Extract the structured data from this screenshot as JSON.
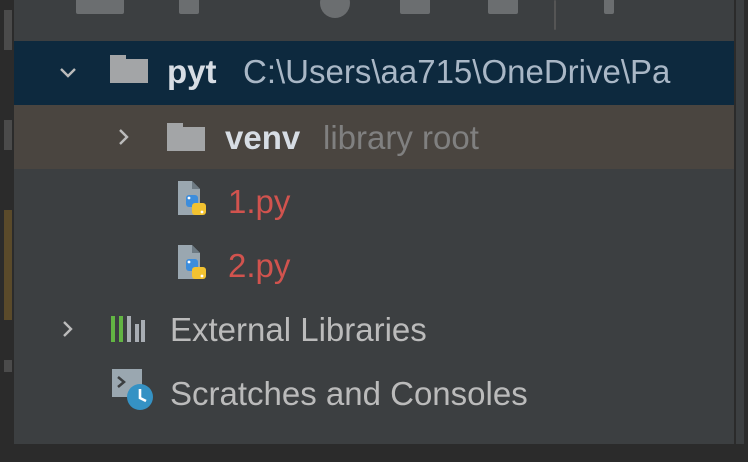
{
  "project_tree": {
    "root": {
      "name": "pyt",
      "path": "C:\\Users\\aa715\\OneDrive\\Pa",
      "expanded": true
    },
    "venv": {
      "name": "venv",
      "hint": "library root",
      "expanded": false
    },
    "files": [
      {
        "name": "1.py"
      },
      {
        "name": "2.py"
      }
    ],
    "external_libraries": {
      "label": "External Libraries"
    },
    "scratches": {
      "label": "Scratches and Consoles"
    }
  },
  "colors": {
    "background": "#3c3f41",
    "selected_row": "#0d293e",
    "hover_row": "#4a4540",
    "unversioned_file": "#d1534e",
    "dim_text": "#808080",
    "scratch_badge": "#3592c4"
  },
  "icons": {
    "chevron_down": "chevron-down-icon",
    "chevron_right": "chevron-right-icon",
    "folder": "folder-icon",
    "python_file": "python-file-icon",
    "libraries": "libraries-icon",
    "scratches": "scratches-icon"
  }
}
